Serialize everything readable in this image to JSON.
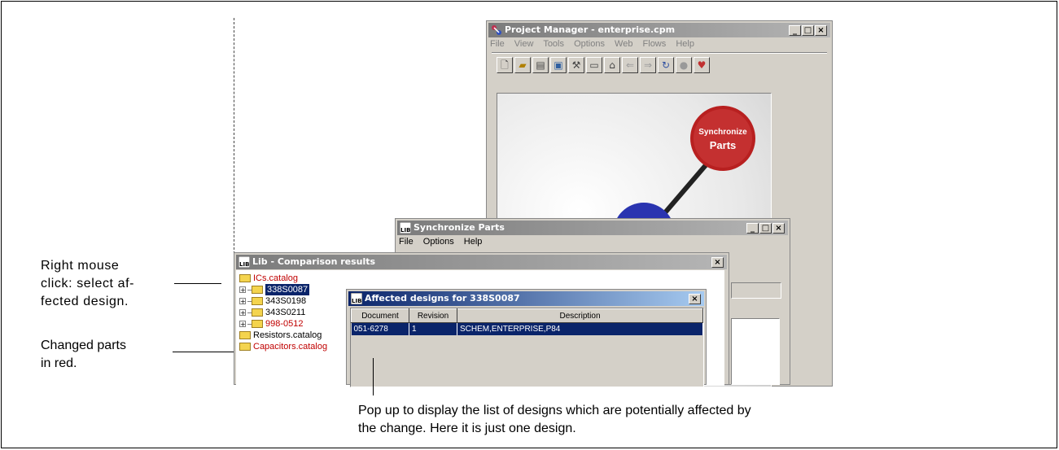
{
  "annotations": {
    "right_click": [
      "Right mouse",
      "click: select af-",
      "fected design."
    ],
    "changed_parts": [
      "Changed parts",
      "in red."
    ],
    "popup": [
      "Pop up to display the list of designs which are potentially affected by",
      "the change. Here it is just one design."
    ]
  },
  "project_manager": {
    "title": "Project Manager - enterprise.cpm",
    "menu": [
      "File",
      "View",
      "Tools",
      "Options",
      "Web",
      "Flows",
      "Help"
    ],
    "toolbar_icons": [
      "new-doc-icon",
      "open-folder-icon",
      "properties-icon",
      "book-icon",
      "tools-icon",
      "ruler-icon",
      "home-icon",
      "back-arrow-icon",
      "forward-arrow-icon",
      "refresh-icon",
      "record-icon",
      "heart-icon"
    ],
    "graphic_label_1": "Synchronize",
    "graphic_label_2": "Parts"
  },
  "sync_parts": {
    "title": "Synchronize Parts",
    "menu": [
      "File",
      "Options",
      "Help"
    ]
  },
  "lib_results": {
    "title": "Lib - Comparison results",
    "tree": [
      {
        "label": "ICs.catalog",
        "level": 0,
        "changed": true,
        "selected": false,
        "expandable": false
      },
      {
        "label": "338S0087",
        "level": 1,
        "changed": false,
        "selected": true,
        "expandable": true
      },
      {
        "label": "343S0198",
        "level": 1,
        "changed": false,
        "selected": false,
        "expandable": true
      },
      {
        "label": "343S0211",
        "level": 1,
        "changed": false,
        "selected": false,
        "expandable": true
      },
      {
        "label": "998-0512",
        "level": 1,
        "changed": true,
        "selected": false,
        "expandable": true
      },
      {
        "label": "Resistors.catalog",
        "level": 0,
        "changed": false,
        "selected": false,
        "expandable": false
      },
      {
        "label": "Capacitors.catalog",
        "level": 0,
        "changed": true,
        "selected": false,
        "expandable": false
      }
    ]
  },
  "affected": {
    "title": "Affected designs for 338S0087",
    "columns": [
      "Document",
      "Revision",
      "Description"
    ],
    "rows": [
      [
        "051-6278",
        "1",
        "SCHEM,ENTERPRISE,P84"
      ]
    ]
  },
  "colors": {
    "changed": "#c00000",
    "selection": "#0a246a",
    "window_bg": "#d4d0c8"
  }
}
